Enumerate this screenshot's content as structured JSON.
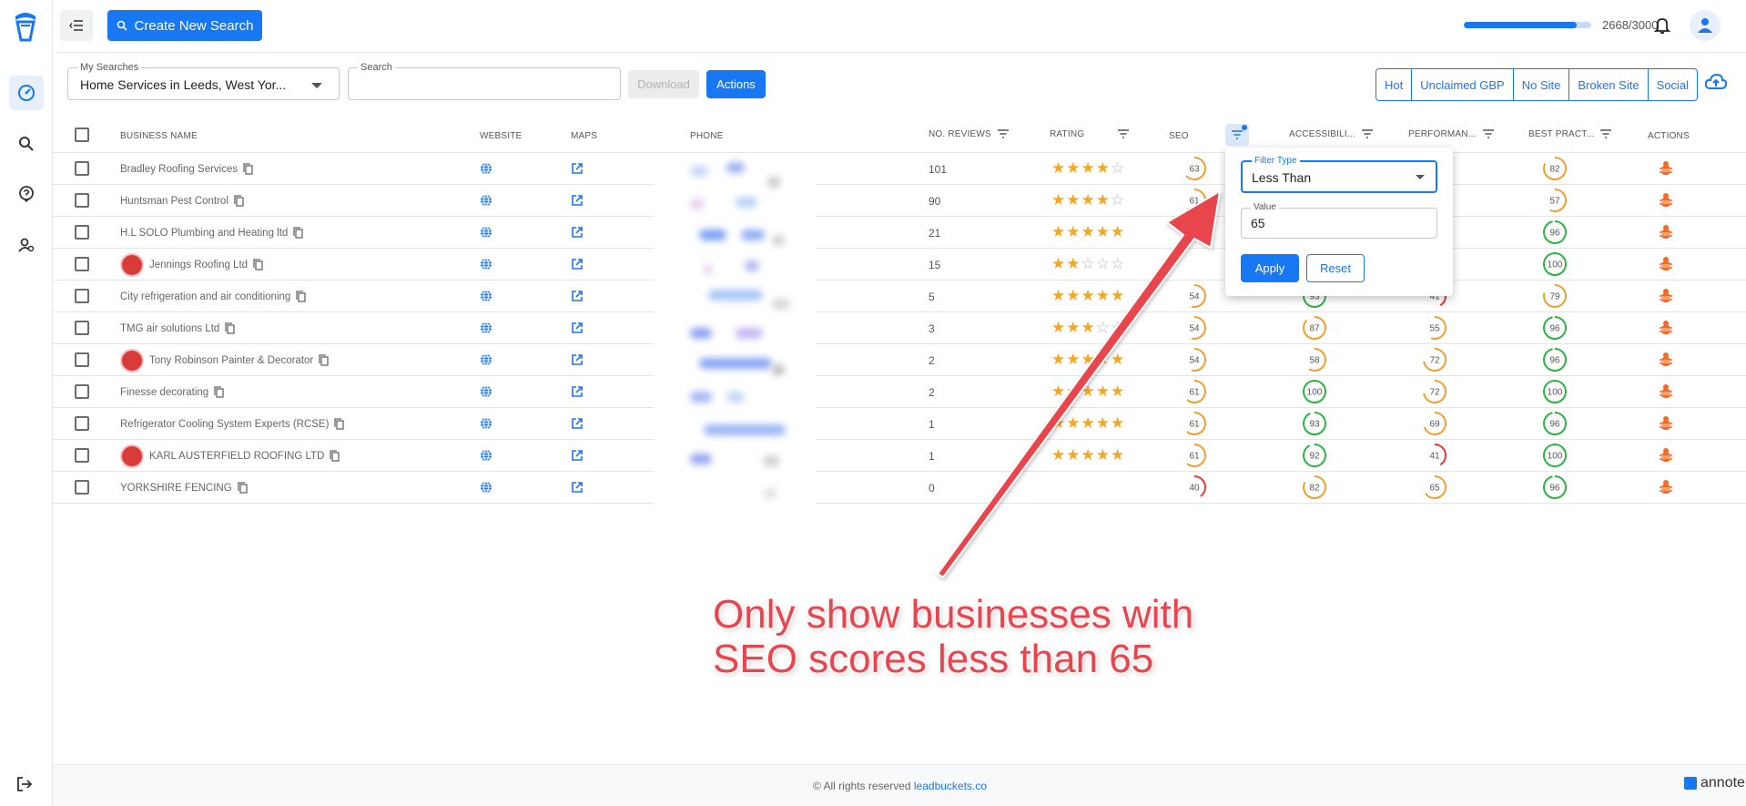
{
  "app": {
    "create_button": "Create New Search",
    "usage_text": "2668/3000",
    "usage_fraction": 0.889
  },
  "filters": {
    "my_searches_label": "My Searches",
    "my_searches_value": "Home Services in Leeds, West Yor...",
    "search_label": "Search",
    "search_value": "",
    "download_label": "Download",
    "actions_label": "Actions",
    "quick_filters": [
      "Hot",
      "Unclaimed GBP",
      "No Site",
      "Broken Site",
      "Social"
    ]
  },
  "table": {
    "headers": {
      "business_name": "BUSINESS NAME",
      "website": "WEBSITE",
      "maps": "MAPS",
      "phone": "PHONE",
      "reviews": "NO. REVIEWS",
      "rating": "RATING",
      "seo": "SEO",
      "accessibility": "ACCESSIBILI...",
      "performance": "PERFORMAN...",
      "best_practices": "BEST PRACT...",
      "actions": "ACTIONS"
    },
    "rows": [
      {
        "name": "Bradley Roofing Services",
        "avatar": false,
        "reviews": "101",
        "rating": 4,
        "seo": "63",
        "acc": "",
        "perf": "",
        "best": "82"
      },
      {
        "name": "Huntsman Pest Control",
        "avatar": false,
        "reviews": "90",
        "rating": 4,
        "seo": "61",
        "acc": "",
        "perf": "",
        "best": "57"
      },
      {
        "name": "H.L SOLO Plumbing and Heating ltd",
        "avatar": false,
        "reviews": "21",
        "rating": 5,
        "seo": "",
        "acc": "",
        "perf": "",
        "best": "96"
      },
      {
        "name": "Jennings Roofing Ltd",
        "avatar": true,
        "reviews": "15",
        "rating": 2,
        "seo": "",
        "acc": "",
        "perf": "",
        "best": "100"
      },
      {
        "name": "City refrigeration and air conditioning",
        "avatar": false,
        "reviews": "5",
        "rating": 5,
        "seo": "54",
        "acc": "93",
        "perf": "41",
        "best": "79"
      },
      {
        "name": "TMG air solutions Ltd",
        "avatar": false,
        "reviews": "3",
        "rating": 3,
        "seo": "54",
        "acc": "87",
        "perf": "55",
        "best": "96"
      },
      {
        "name": "Tony Robinson Painter & Decorator",
        "avatar": true,
        "reviews": "2",
        "rating": 5,
        "seo": "54",
        "acc": "58",
        "perf": "72",
        "best": "96"
      },
      {
        "name": "Finesse decorating",
        "avatar": false,
        "reviews": "2",
        "rating": 5,
        "seo": "61",
        "acc": "100",
        "perf": "72",
        "best": "100"
      },
      {
        "name": "Refrigerator Cooling System Experts (RCSE)",
        "avatar": false,
        "reviews": "1",
        "rating": 5,
        "seo": "61",
        "acc": "93",
        "perf": "69",
        "best": "96"
      },
      {
        "name": "KARL AUSTERFIELD ROOFING LTD",
        "avatar": true,
        "reviews": "1",
        "rating": 5,
        "seo": "61",
        "acc": "92",
        "perf": "41",
        "best": "100"
      },
      {
        "name": "YORKSHIRE FENCING",
        "avatar": false,
        "reviews": "0",
        "rating": 0,
        "seo": "40",
        "acc": "82",
        "perf": "65",
        "best": "96"
      }
    ]
  },
  "popover": {
    "filter_type_label": "Filter Type",
    "filter_type_value": "Less Than",
    "value_label": "Value",
    "value": "65",
    "apply_label": "Apply",
    "reset_label": "Reset"
  },
  "annotation": {
    "line1": "Only show businesses with",
    "line2": "SEO scores less than 65"
  },
  "footer": {
    "text": "© All rights reserved ",
    "link": "leadbuckets.co",
    "watermark": "annotely.com"
  },
  "colors": {
    "primary": "#1877f2",
    "score_green": "#2fb344",
    "score_orange": "#f0a030",
    "score_red": "#e53935",
    "annotation_red": "#e8454e"
  }
}
